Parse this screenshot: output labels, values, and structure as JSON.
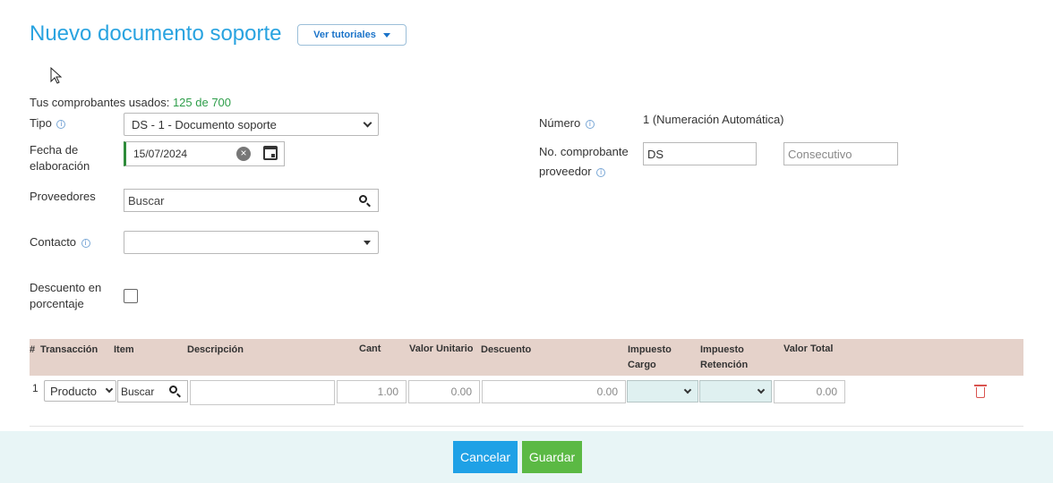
{
  "page": {
    "title": "Nuevo documento soporte",
    "tutorials_label": "Ver tutoriales"
  },
  "usage": {
    "label": "Tus comprobantes usados:",
    "count": "125 de 700"
  },
  "form": {
    "tipo_label": "Tipo",
    "tipo_value": "DS - 1 - Documento soporte",
    "fecha_label_1": "Fecha de",
    "fecha_label_2": "elaboración",
    "fecha_value": "15/07/2024",
    "proveedores_label": "Proveedores",
    "proveedores_placeholder": "Buscar",
    "contacto_label": "Contacto",
    "contacto_value": "",
    "descuento_label_1": "Descuento en",
    "descuento_label_2": "porcentaje",
    "descuento_checked": false,
    "numero_label": "Número",
    "numero_value": "1 (Numeración Automática)",
    "comprobante_label_1": "No. comprobante",
    "comprobante_label_2": "proveedor",
    "comprobante_prefix": "DS",
    "comprobante_placeholder": "Consecutivo"
  },
  "table": {
    "headers": {
      "num": "#",
      "transaccion": "Transacción",
      "item": "Item",
      "descripcion": "Descripción",
      "cant": "Cant",
      "valor_unitario": "Valor Unitario",
      "descuento": "Descuento",
      "impuesto_cargo_1": "Impuesto",
      "impuesto_cargo_2": "Cargo",
      "impuesto_retencion_1": "Impuesto",
      "impuesto_retencion_2": "Retención",
      "valor_total": "Valor Total"
    },
    "rows": [
      {
        "num": "1",
        "transaccion": "Producto",
        "item_placeholder": "Buscar",
        "descripcion": "",
        "cant": "1.00",
        "valor_unitario": "0.00",
        "descuento": "0.00",
        "impuesto_cargo": "",
        "impuesto_retencion": "",
        "valor_total": "0.00"
      }
    ]
  },
  "footer": {
    "cancel_label": "Cancelar",
    "save_label": "Guardar"
  },
  "colors": {
    "title": "#29a3e0",
    "count": "#2e9e4a",
    "table_header": "#e5d2ca",
    "cancel": "#1fa1e6",
    "save": "#5bb944",
    "footer_bg": "#e8f5f6",
    "delete": "#d9534f"
  },
  "icons": [
    "info-icon",
    "clear-icon",
    "calendar-icon",
    "search-icon",
    "chevron-down-icon",
    "caret-down-icon",
    "trash-icon",
    "mouse-cursor-icon"
  ]
}
